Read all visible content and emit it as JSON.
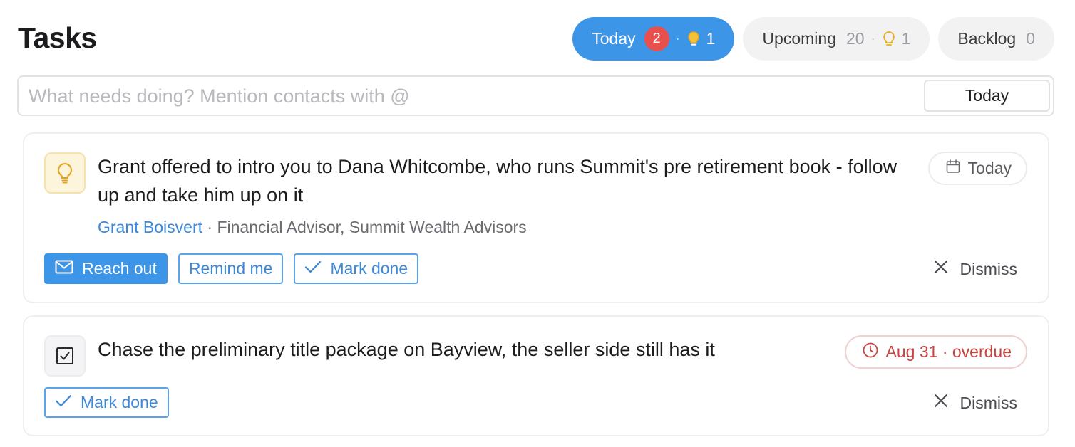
{
  "page": {
    "title": "Tasks"
  },
  "tabs": [
    {
      "label": "Today",
      "count": "2",
      "suggestions": "1",
      "active": true
    },
    {
      "label": "Upcoming",
      "count": "20",
      "suggestions": "1",
      "active": false
    },
    {
      "label": "Backlog",
      "count": "0",
      "active": false
    }
  ],
  "composer": {
    "placeholder": "What needs doing? Mention contacts with @",
    "value": "",
    "date_label": "Today"
  },
  "tasks": [
    {
      "type": "suggestion",
      "type_icon": "lightbulb-icon",
      "title": "Grant offered to intro you to Dana Whitcombe, who runs Summit's pre retirement book - follow up and take him up on it",
      "contact_name": "Grant Boisvert",
      "contact_meta": "Financial Advisor, Summit Wealth Advisors",
      "due_label": "Today",
      "due_icon": "calendar-icon",
      "actions": {
        "reach_out": "Reach out",
        "remind_me": "Remind me",
        "mark_done": "Mark done"
      },
      "dismiss": "Dismiss"
    },
    {
      "type": "task",
      "type_icon": "checkbox-icon",
      "title": "Chase the preliminary title package on Bayview, the seller side still has it",
      "due_label": "Aug 31 · overdue",
      "due_icon": "clock-icon",
      "actions": {
        "mark_done": "Mark done"
      },
      "dismiss": "Dismiss"
    }
  ],
  "colors": {
    "accent": "#3d95e8",
    "badge": "#e8504d",
    "overdue": "#c8453f",
    "suggestion_bulb": "#e9b020"
  }
}
